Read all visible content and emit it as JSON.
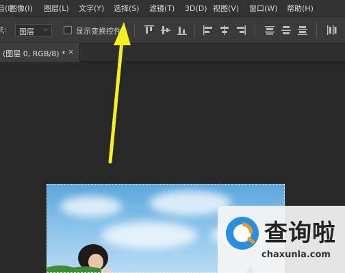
{
  "menubar": {
    "items": [
      {
        "label": "图层(L)"
      },
      {
        "label": "文字(Y)"
      },
      {
        "label": "选择(S)"
      },
      {
        "label": "滤镜(T)"
      },
      {
        "label": "3D(D)"
      },
      {
        "label": "视图(V)"
      },
      {
        "label": "窗口(W)"
      },
      {
        "label": "帮助(H)"
      }
    ],
    "partial_items": [
      "目(I)",
      "图像(I)"
    ]
  },
  "options_bar": {
    "partial_label": "ξ:",
    "layer_select_value": "图层",
    "show_transform_label": "显示变换控件",
    "align_icons": [
      "align-top-edges-icon",
      "align-vertical-centers-icon",
      "align-bottom-edges-icon",
      "align-left-edges-icon",
      "align-horizontal-centers-icon",
      "align-right-edges-icon",
      "distribute-top-icon",
      "distribute-vertical-centers-icon",
      "distribute-bottom-icon",
      "distribute-left-icon"
    ]
  },
  "document_tab": {
    "title": "(图层 0, RGB/8) *",
    "close_glyph": "×"
  },
  "colors": {
    "annotation_arrow": "#f5f01e",
    "menubar_bg": "#323232",
    "workspace_bg": "#282828"
  },
  "watermark": {
    "title": "查询啦",
    "url": "chaxunla.com"
  }
}
